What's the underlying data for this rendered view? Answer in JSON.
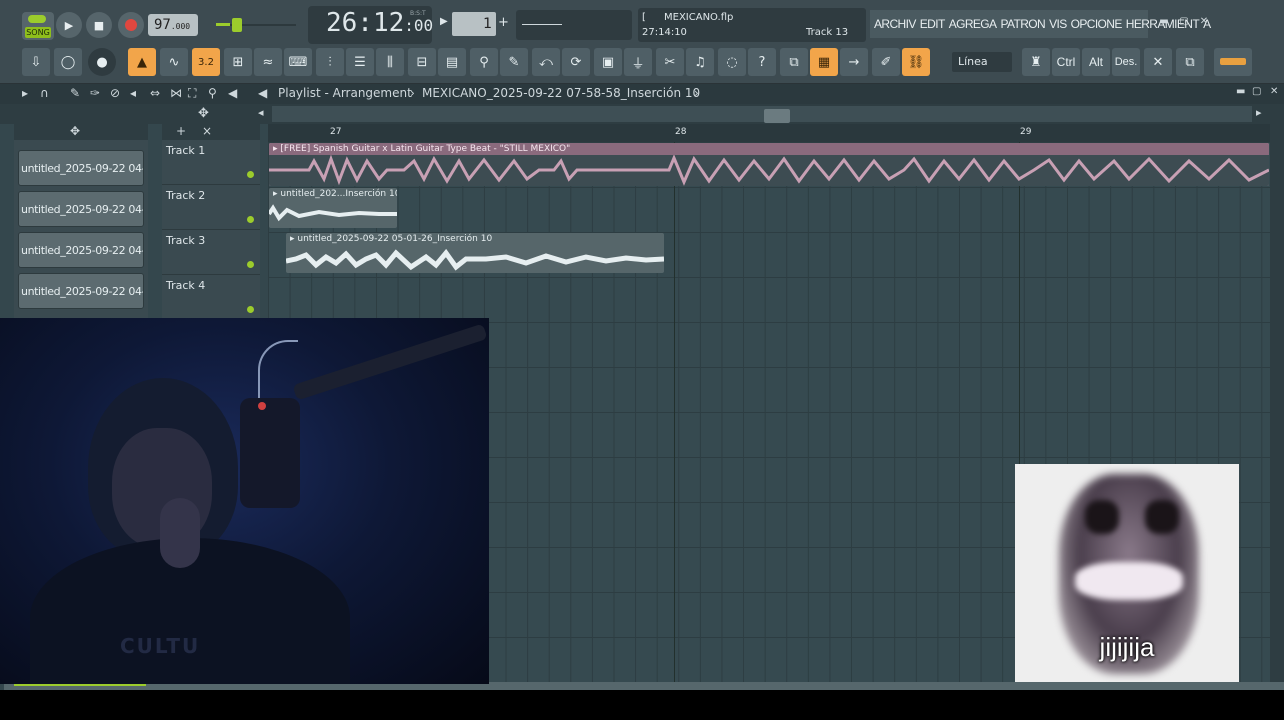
{
  "colors": {
    "accent_green": "#9ccc2c",
    "orange": "#f2a54a",
    "clip_pink": "#c8a0b4",
    "panel": "#3d4b51"
  },
  "transport": {
    "song_label": "SONG",
    "tempo_main": "97",
    "tempo_frac": ".000",
    "clock": "26:12",
    "clock_sub": ":00",
    "clock_tag": "B:S:T",
    "pattern": "1"
  },
  "hint": {
    "file": "MEXICANO.flp",
    "time": "27:14:10",
    "track": "Track 13"
  },
  "menu": [
    "ARCHIV",
    "EDIT",
    "AGREGA",
    "PATRON",
    "VIS",
    "OPCIONE",
    "HERRAMIENT",
    "A"
  ],
  "toolbar": {
    "snap_label": "Línea",
    "ctrl": "Ctrl",
    "alt": "Alt",
    "des": "Des.",
    "icons": [
      "import-icon",
      "loop-icon",
      "knob-icon",
      "metronome-icon",
      "waveform-icon",
      "counter-icon",
      "step-icon",
      "blend-icon",
      "typing-icon",
      "mixer-icon",
      "channel-rack-icon",
      "piano-roll-icon",
      "browser-icon",
      "plugin-icon",
      "playlist-icon",
      "brush-icon",
      "undo-icon",
      "save-icon",
      "render-icon",
      "cut-icon",
      "mic-icon",
      "chat-icon",
      "help-icon",
      "detach-icon",
      "keyboard-icon",
      "arrow-icon",
      "pencil-icon",
      "link-icon"
    ]
  },
  "playlist": {
    "title": "Playlist - Arrangement",
    "pattern_name": "MEXICANO_2025-09-22 07-58-58_Inserción 10",
    "bars": [
      "27",
      "28",
      "29"
    ],
    "tracks": [
      "Track 1",
      "Track 2",
      "Track 3",
      "Track 4"
    ],
    "browser_items": [
      "untitled_2025-09-22 04-...",
      "untitled_2025-09-22 04-...",
      "untitled_2025-09-22 04-...",
      "untitled_2025-09-22 04-..."
    ],
    "clips": [
      {
        "label": "[FREE] Spanish Guitar x Latin Guitar Type Beat - \"STILL MEXICO\""
      },
      {
        "label": "untitled_202...Inserción 10"
      },
      {
        "label": "untitled_2025-09-22 05-01-26_Inserción 10"
      }
    ]
  },
  "overlays": {
    "meme_text": "jijijija",
    "shirt_text": "CULTU"
  }
}
